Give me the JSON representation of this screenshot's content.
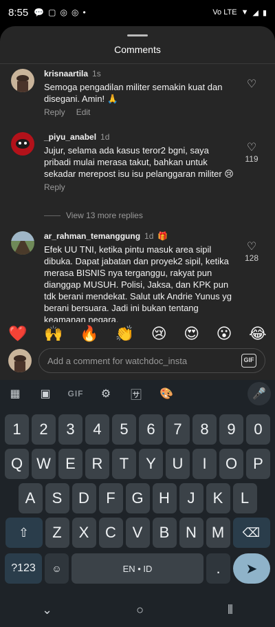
{
  "status": {
    "time": "8:55",
    "network": "Vo LTE"
  },
  "sheet": {
    "title": "Comments"
  },
  "comments": [
    {
      "user": "krisnaartila",
      "time": "1s",
      "text": "Semoga pengadilan militer semakin kuat dan disegani. Amin! 🙏",
      "reply": "Reply",
      "edit": "Edit",
      "likes": ""
    },
    {
      "user": "_piyu_anabel",
      "time": "1d",
      "text": "Jujur, selama ada kasus teror2 bgni, saya pribadi mulai merasa takut, bahkan untuk sekadar merepost isu isu pelanggaran militer 😢",
      "reply": "Reply",
      "likes": "119"
    },
    {
      "user": "ar_rahman_temanggung",
      "time": "1d",
      "text": "Efek UU TNI, ketika pintu masuk area sipil dibuka. Dapat jabatan dan proyek2 sipil, ketika merasa BISNIS nya terganggu, rakyat pun dianggap MUSUH. Polisi, Jaksa, dan KPK pun tdk berani mendekat. Salut utk Andrie Yunus yg berani bersuara. Jadi ini bukan tentang keamanan negara.",
      "likes": "128"
    }
  ],
  "more_replies": "View 13 more replies",
  "reactions": [
    "❤️",
    "🙌",
    "🔥",
    "👏",
    "😢",
    "😍",
    "😮",
    "😂"
  ],
  "composer": {
    "placeholder": "Add a comment for watchdoc_insta",
    "gif": "GIF"
  },
  "keyboard": {
    "toolbar_gif": "GIF",
    "row_numbers": [
      "1",
      "2",
      "3",
      "4",
      "5",
      "6",
      "7",
      "8",
      "9",
      "0"
    ],
    "row1": [
      "Q",
      "W",
      "E",
      "R",
      "T",
      "Y",
      "U",
      "I",
      "O",
      "P"
    ],
    "row2": [
      "A",
      "S",
      "D",
      "F",
      "G",
      "H",
      "J",
      "K",
      "L"
    ],
    "row3": [
      "Z",
      "X",
      "C",
      "V",
      "B",
      "N",
      "M"
    ],
    "sym": "?123",
    "emoji": "☺",
    "space": "EN • ID",
    "period": ".",
    "comma": ","
  }
}
